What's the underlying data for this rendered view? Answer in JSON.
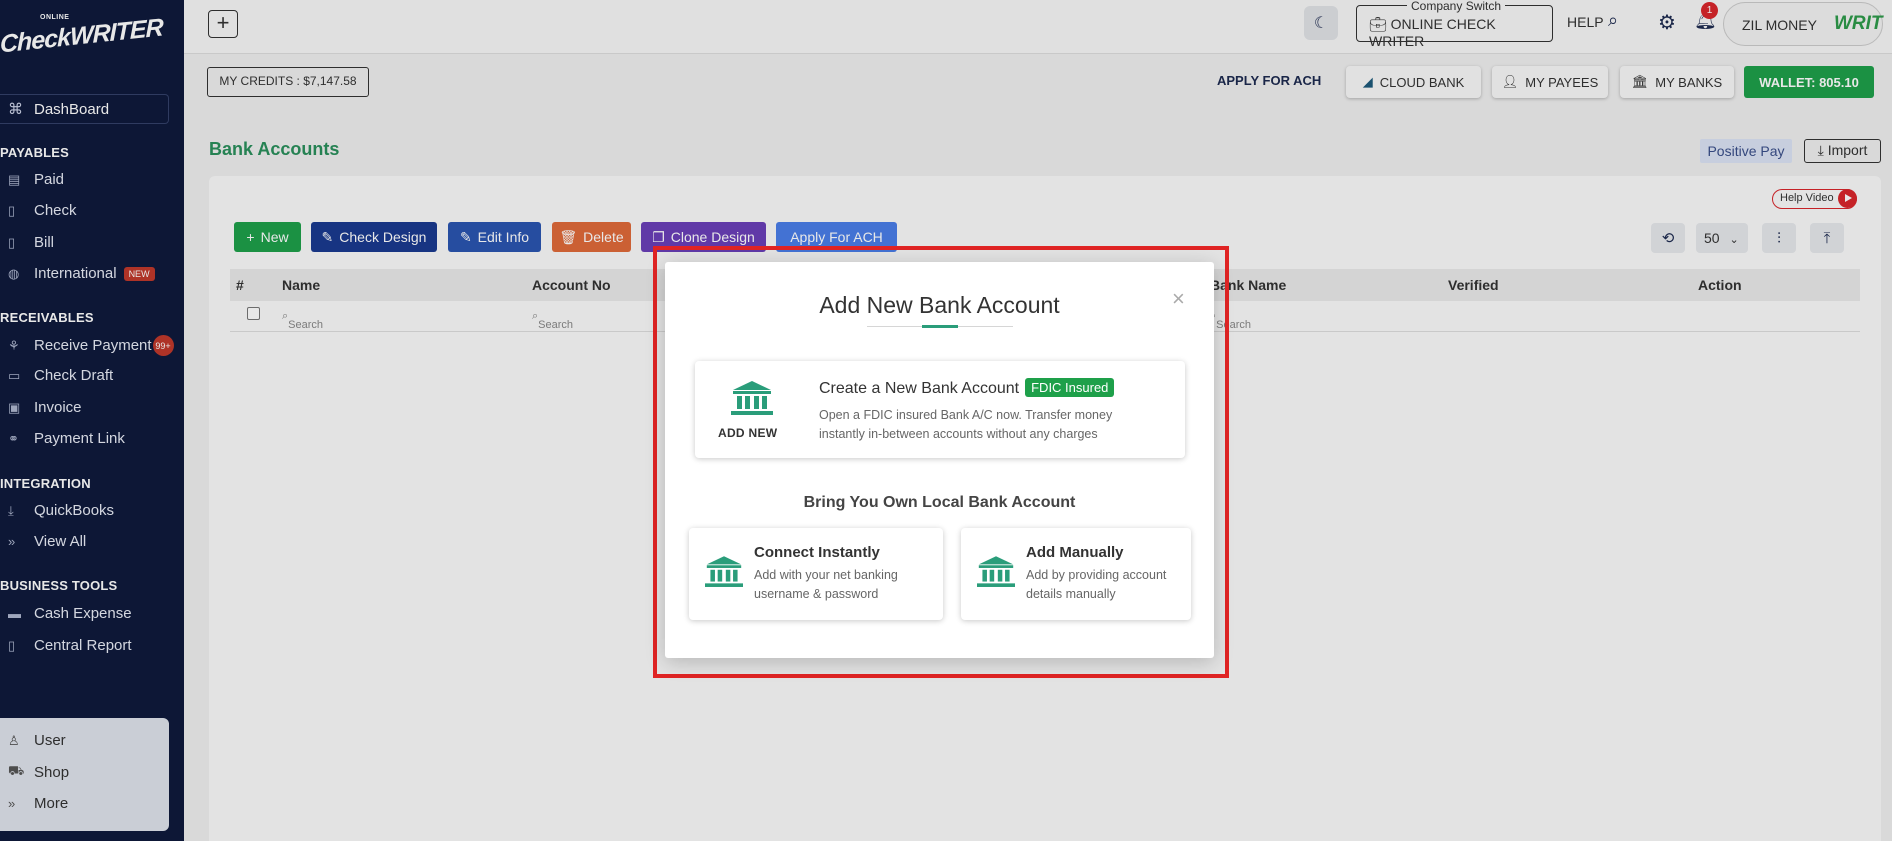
{
  "sidebar": {
    "logo_small": "ONLINE",
    "logo_big": "CheckWRITER",
    "dashboard": "DashBoard",
    "sections": {
      "payables": "PAYABLES",
      "receivables": "RECEIVABLES",
      "integration": "INTEGRATION",
      "business_tools": "BUSINESS TOOLS"
    },
    "payables_items": [
      "Paid",
      "Check",
      "Bill",
      "International"
    ],
    "international_badge": "NEW",
    "receivables_items": [
      "Receive Payment",
      "Check Draft",
      "Invoice",
      "Payment Link"
    ],
    "receive_badge": "99+",
    "integration_items": [
      "QuickBooks",
      "View All"
    ],
    "business_items": [
      "Cash Expense",
      "Central Report"
    ],
    "bottom_items": [
      "User",
      "Shop",
      "More"
    ]
  },
  "topbar": {
    "company_switch_label": "Company Switch",
    "company_switch_value": "ONLINE CHECK WRITER",
    "help": "HELP",
    "notification_count": "1",
    "account_name": "ZIL MONEY",
    "account_logo": "WRIT"
  },
  "subbar": {
    "credits": "MY CREDITS : $7,147.58",
    "apply_ach": "APPLY FOR ACH",
    "cloud_bank": "CLOUD BANK",
    "my_payees": "MY PAYEES",
    "my_banks": "MY BANKS",
    "wallet": "WALLET: 805.10"
  },
  "page": {
    "title": "Bank Accounts",
    "positive_pay": "Positive Pay",
    "import": "Import",
    "help_video": "Help Video"
  },
  "toolbar": {
    "new": "New",
    "check_design": "Check Design",
    "edit_info": "Edit Info",
    "delete": "Delete",
    "clone_design": "Clone Design",
    "apply_ach": "Apply For ACH",
    "per_page": "50"
  },
  "table": {
    "columns": [
      "#",
      "Name",
      "Account No",
      "Bank Name",
      "Verified",
      "Action"
    ],
    "search_placeholder": "Search"
  },
  "modal": {
    "title": "Add New Bank Account",
    "create_title": "Create a New Bank Account",
    "fdic_badge": "FDIC Insured",
    "create_desc": "Open a FDIC insured Bank A/C now. Transfer money instantly in-between accounts without any charges",
    "add_new_label": "ADD NEW",
    "byo_heading": "Bring You Own Local Bank Account",
    "connect_title": "Connect Instantly",
    "connect_desc": "Add with your net banking username & password",
    "manual_title": "Add Manually",
    "manual_desc": "Add by providing account details manually"
  },
  "colors": {
    "sidebar_bg": "#0f1a3c",
    "accent_green": "#1ea04a",
    "bank_icon_teal": "#2a9d7a",
    "highlight_red": "#e02424"
  }
}
